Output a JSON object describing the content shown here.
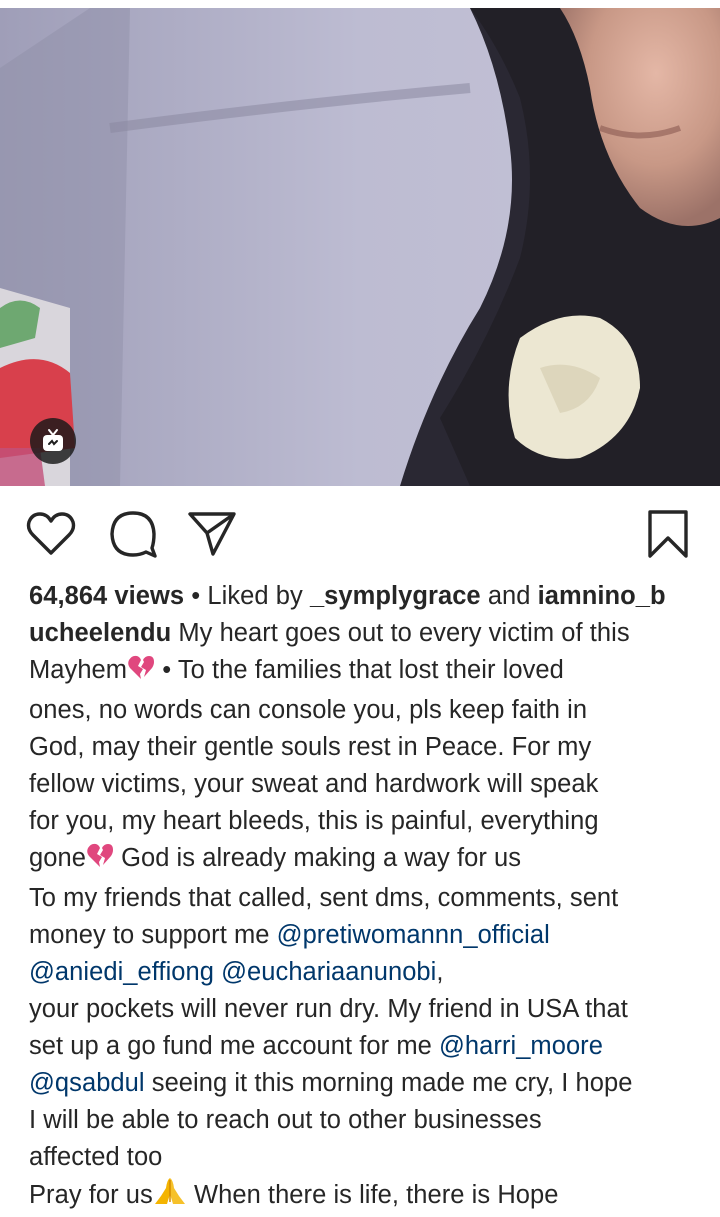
{
  "post": {
    "igtv_icon": "igtv-icon",
    "views": "64,864 views",
    "liked_sep": "•",
    "liked_by": "Liked by",
    "liker_1": "_symplygrace",
    "liked_and": "and",
    "liker_2": "iamnino_b",
    "author": "ucheelendu"
  },
  "actions": {
    "like_icon": "heart-outline-icon",
    "comment_icon": "comment-bubble-icon",
    "share_icon": "paper-plane-icon",
    "save_icon": "bookmark-icon"
  },
  "caption": {
    "l1": "My heart goes out to every victim of this",
    "l2a": "Mayhem",
    "l2b": "• To the families that lost their loved",
    "l3": "ones, no words can console you, pls keep faith in",
    "l4": "God, may their gentle souls rest in Peace. For my",
    "l5": "fellow victims, your sweat and hardwork will speak",
    "l6": "for you, my heart bleeds, this is painful, everything",
    "l7a": "gone",
    "l7b": "God is already making a way for us",
    "l8": "To my friends that called, sent dms, comments, sent",
    "l9a": "money to support me",
    "m_preti": "@pretiwomannn_official",
    "m_aniedi": "@aniedi_effiong",
    "m_eucharia": "@euchariaanunobi",
    "l10_end": ",",
    "l11": "your pockets will never run dry. My friend in USA that",
    "l12a": "set up a go fund me account for me",
    "m_harri": "@harri_moore",
    "m_qsabdul": "@qsabdul",
    "l13b": "seeing it this morning made me cry, I hope",
    "l14": "I will be able to reach out to other businesses",
    "l15": "affected too",
    "l16a": "Pray for us",
    "l16b": "When there is life, there is Hope",
    "emoji_broken_heart": "broken-heart-emoji",
    "emoji_pray": "folded-hands-emoji"
  }
}
